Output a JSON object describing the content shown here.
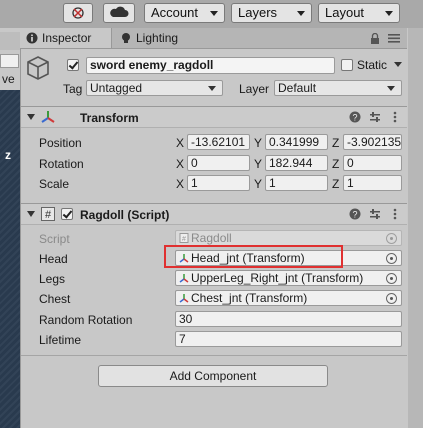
{
  "toolbar": {
    "account_label": "Account",
    "layers_label": "Layers",
    "layout_label": "Layout"
  },
  "left_strip": {
    "fragment_top": "ve",
    "fragment_z": "z"
  },
  "tabs": {
    "inspector": "Inspector",
    "lighting": "Lighting"
  },
  "object": {
    "active": true,
    "name": "sword enemy_ragdoll",
    "static_label": "Static",
    "static": false,
    "tag_label": "Tag",
    "tag_value": "Untagged",
    "layer_label": "Layer",
    "layer_value": "Default"
  },
  "transform": {
    "title": "Transform",
    "position_label": "Position",
    "rotation_label": "Rotation",
    "scale_label": "Scale",
    "position": {
      "x": "-13.62101",
      "y": "0.341999",
      "z": "-3.902135"
    },
    "rotation": {
      "x": "0",
      "y": "182.944",
      "z": "0"
    },
    "scale": {
      "x": "1",
      "y": "1",
      "z": "1"
    },
    "axis_x": "X",
    "axis_y": "Y",
    "axis_z": "Z"
  },
  "ragdoll": {
    "title": "Ragdoll (Script)",
    "enabled": true,
    "script_label": "Script",
    "script_value": "Ragdoll",
    "head_label": "Head",
    "head_value": "Head_jnt (Transform)",
    "legs_label": "Legs",
    "legs_value": "UpperLeg_Right_jnt (Transform)",
    "chest_label": "Chest",
    "chest_value": "Chest_jnt (Transform)",
    "random_rotation_label": "Random Rotation",
    "random_rotation_value": "30",
    "lifetime_label": "Lifetime",
    "lifetime_value": "7"
  },
  "add_component_label": "Add Component",
  "highlight_color": "#e03030"
}
